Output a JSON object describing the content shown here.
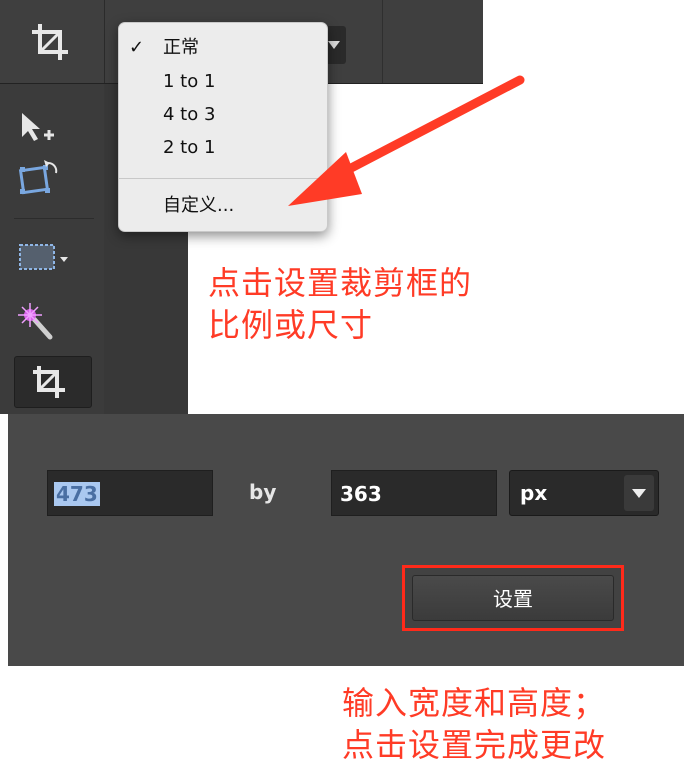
{
  "dropdown": {
    "selected_check": "✓",
    "items": [
      "正常",
      "1 to 1",
      "4 to 3",
      "2 to 1"
    ],
    "custom": "自定义..."
  },
  "annotations": {
    "line1_a": "点击设置裁剪框的",
    "line1_b": "比例或尺寸",
    "line2_a": "输入宽度和高度；",
    "line2_b": "点击设置完成更改"
  },
  "crop_size": {
    "width": "473",
    "by_label": "by",
    "height": "363",
    "unit": "px",
    "apply_label": "设置"
  },
  "colors": {
    "annotation": "#ff3b26",
    "highlight": "#ff2a1a"
  },
  "icons": [
    "crop-icon",
    "move-add-icon",
    "rotate-transform-icon",
    "marquee-select-icon",
    "magic-wand-icon",
    "crop-tool-icon"
  ]
}
